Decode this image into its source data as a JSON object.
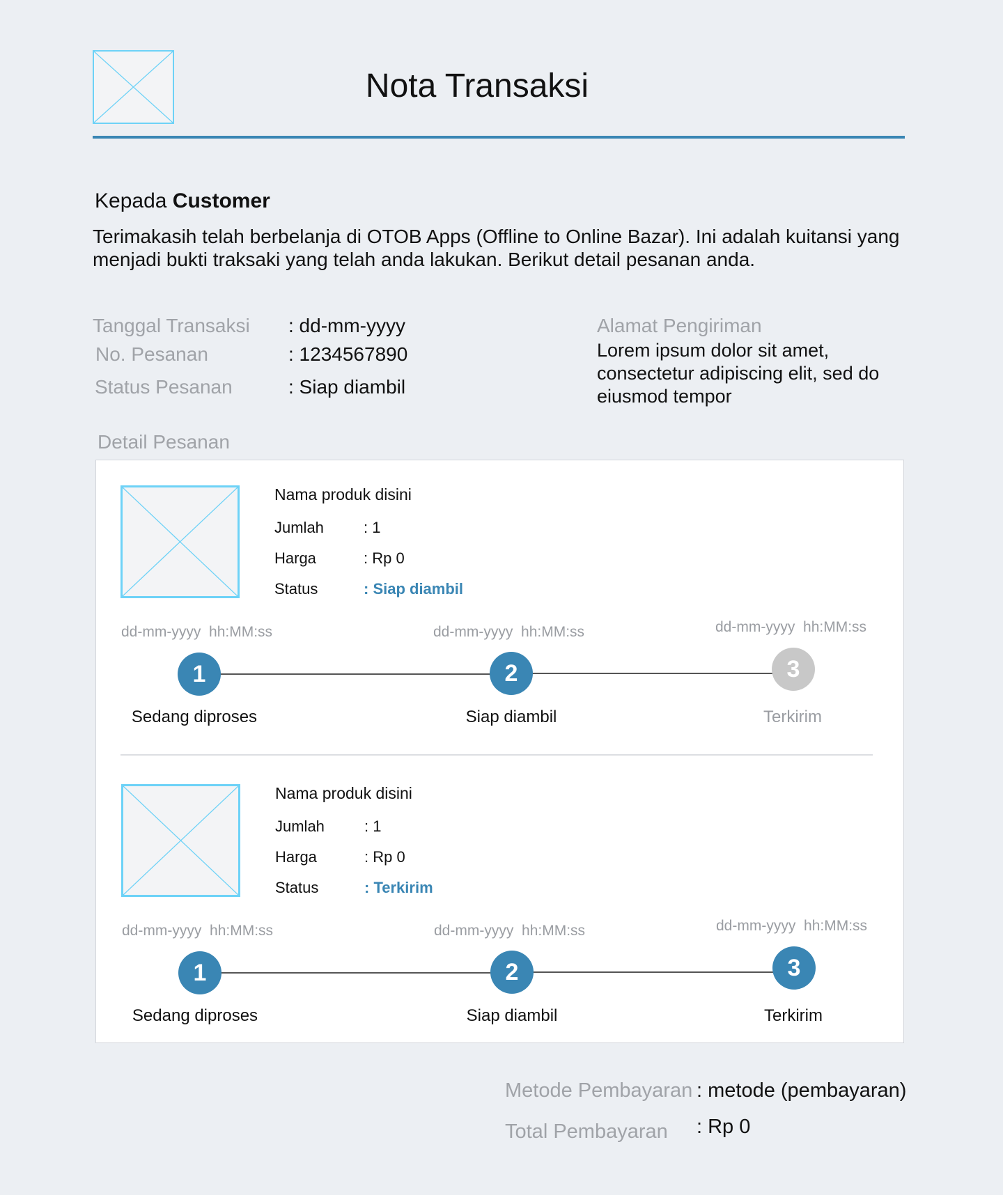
{
  "header": {
    "logo_icon": "image-placeholder-icon",
    "title": "Nota Transaksi",
    "accent": "#3a86b4"
  },
  "greeting": {
    "prefix": "Kepada ",
    "name": "Customer"
  },
  "intro": "Terimakasih telah berbelanja di OTOB Apps (Offline to Online Bazar). Ini adalah kuitansi yang menjadi bukti traksaki yang telah anda lakukan. Berikut detail pesanan anda.",
  "info": {
    "date_label": "Tanggal Transaksi",
    "date_value": ": dd-mm-yyyy",
    "order_label": "No. Pesanan",
    "order_value": ": 1234567890",
    "status_label": "Status Pesanan",
    "status_value": ": Siap diambil",
    "address_label": "Alamat Pengiriman",
    "address_value": "Lorem ipsum dolor sit amet, consectetur adipiscing elit, sed do eiusmod tempor"
  },
  "detail_label": "Detail Pesanan",
  "items": [
    {
      "image_icon": "image-placeholder-icon",
      "name": "Nama produk disini",
      "qty_label": "Jumlah",
      "qty_value": ": 1",
      "price_label": "Harga",
      "price_value": ": Rp 0",
      "status_label": "Status",
      "status_value": ": Siap diambil",
      "steps": [
        {
          "date": "dd-mm-yyyy",
          "time": "hh:MM:ss",
          "number": "1",
          "label": "Sedang diproses",
          "done": true
        },
        {
          "date": "dd-mm-yyyy",
          "time": "hh:MM:ss",
          "number": "2",
          "label": "Siap diambil",
          "done": true
        },
        {
          "date": "dd-mm-yyyy",
          "time": "hh:MM:ss",
          "number": "3",
          "label": "Terkirim",
          "done": false
        }
      ]
    },
    {
      "image_icon": "image-placeholder-icon",
      "name": "Nama produk disini",
      "qty_label": "Jumlah",
      "qty_value": ": 1",
      "price_label": "Harga",
      "price_value": ": Rp 0",
      "status_label": "Status",
      "status_value": ": Terkirim",
      "steps": [
        {
          "date": "dd-mm-yyyy",
          "time": "hh:MM:ss",
          "number": "1",
          "label": "Sedang diproses",
          "done": true
        },
        {
          "date": "dd-mm-yyyy",
          "time": "hh:MM:ss",
          "number": "2",
          "label": "Siap diambil",
          "done": true
        },
        {
          "date": "dd-mm-yyyy",
          "time": "hh:MM:ss",
          "number": "3",
          "label": "Terkirim",
          "done": true
        }
      ]
    }
  ],
  "payment": {
    "method_label": "Metode Pembayaran",
    "method_value": ": metode (pembayaran)",
    "total_label": "Total Pembayaran",
    "total_value": ": Rp 0"
  },
  "colors": {
    "done_step": "#3a86b4",
    "pending_step": "#c8c8c8",
    "placeholder_border": "#6dd2f7"
  }
}
